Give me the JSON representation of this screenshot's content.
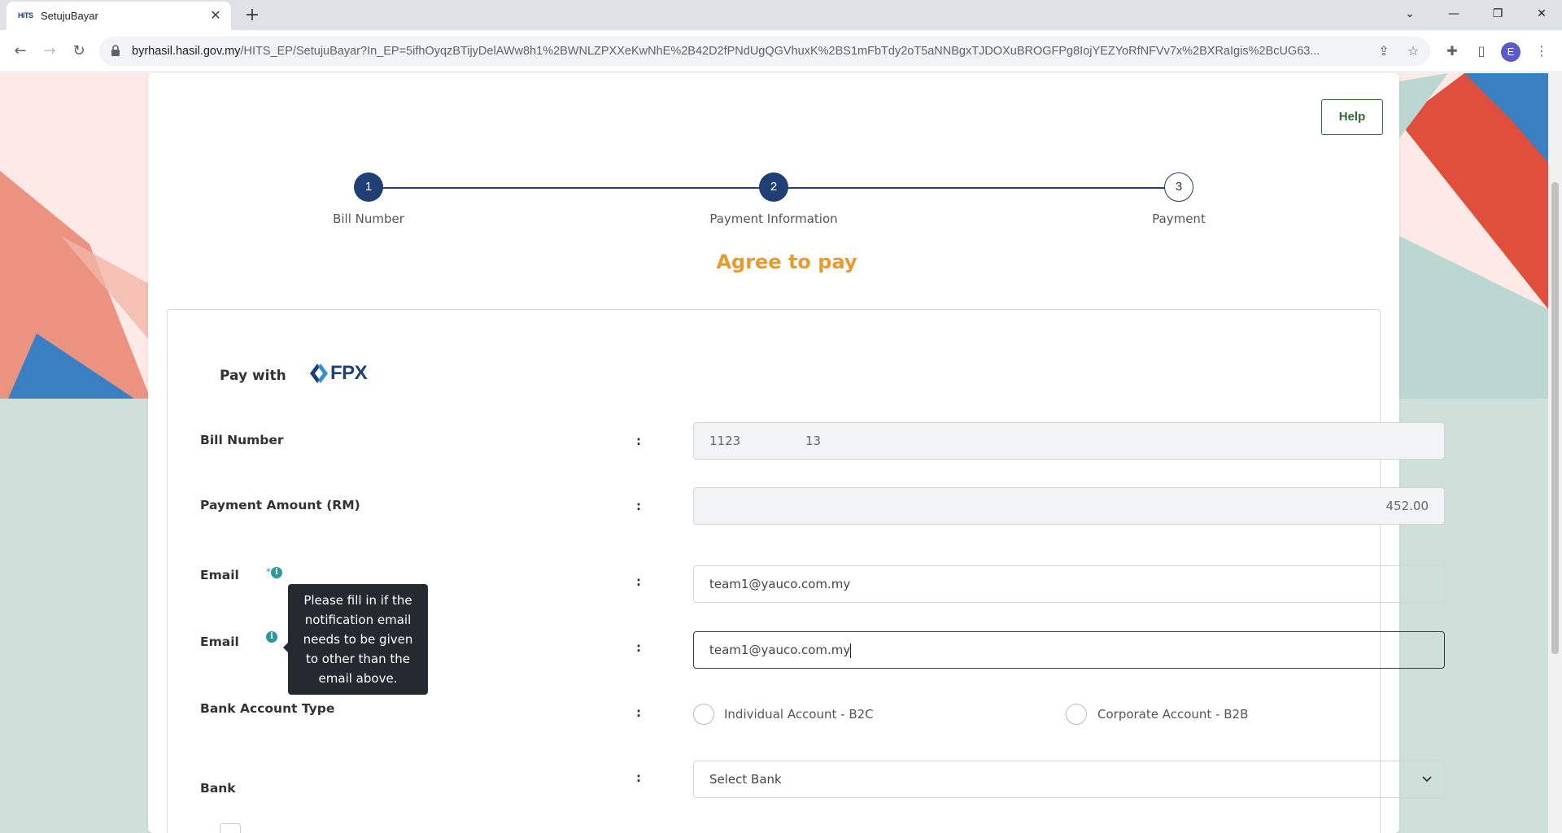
{
  "browser": {
    "tab_title": "SetujuBayar",
    "favicon_text": "HiTS",
    "url_host": "byrhasil.hasil.gov.my",
    "url_rest": "/HITS_EP/SetujuBayar?In_EP=5ifhOyqzBTijyDelAWw8h1%2BWNLZPXXeKwNhE%2B42D2fPNdUgQGVhuxK%2BS1mFbTdy2oT5aNNBgxTJDOXuBROGFPg8IojYEZYoRfNFVv7x%2BXRaIgis%2BcUG63...",
    "profile_initial": "E"
  },
  "page": {
    "help_label": "Help",
    "steps": [
      {
        "number": "1",
        "label": "Bill Number"
      },
      {
        "number": "2",
        "label": "Payment Information"
      },
      {
        "number": "3",
        "label": "Payment"
      }
    ],
    "heading": "Agree to pay",
    "pay_with_label": "Pay with",
    "fpx_text": "FPX",
    "form": {
      "bill_number_label": "Bill Number",
      "bill_number_part1": "1123",
      "bill_number_part2": "13",
      "amount_label": "Payment Amount (RM)",
      "amount_value": "452.00",
      "email_label": "Email",
      "email_value": "team1@yauco.com.my",
      "email2_label": "Email",
      "email2_value": "team1@yauco.com.my",
      "required_mark": "*",
      "tooltip": "Please fill in if the notification email needs to be given to other than the email above.",
      "account_type_label": "Bank Account Type",
      "account_option_1": "Individual Account - B2C",
      "account_option_2": "Corporate Account - B2B",
      "bank_label": "Bank",
      "bank_placeholder": "Select Bank",
      "colon": ":"
    }
  },
  "colors": {
    "primary": "#1f3f75",
    "heading": "#e89b2c",
    "help_green": "#2e6b36",
    "info_teal": "#2a9a99"
  }
}
